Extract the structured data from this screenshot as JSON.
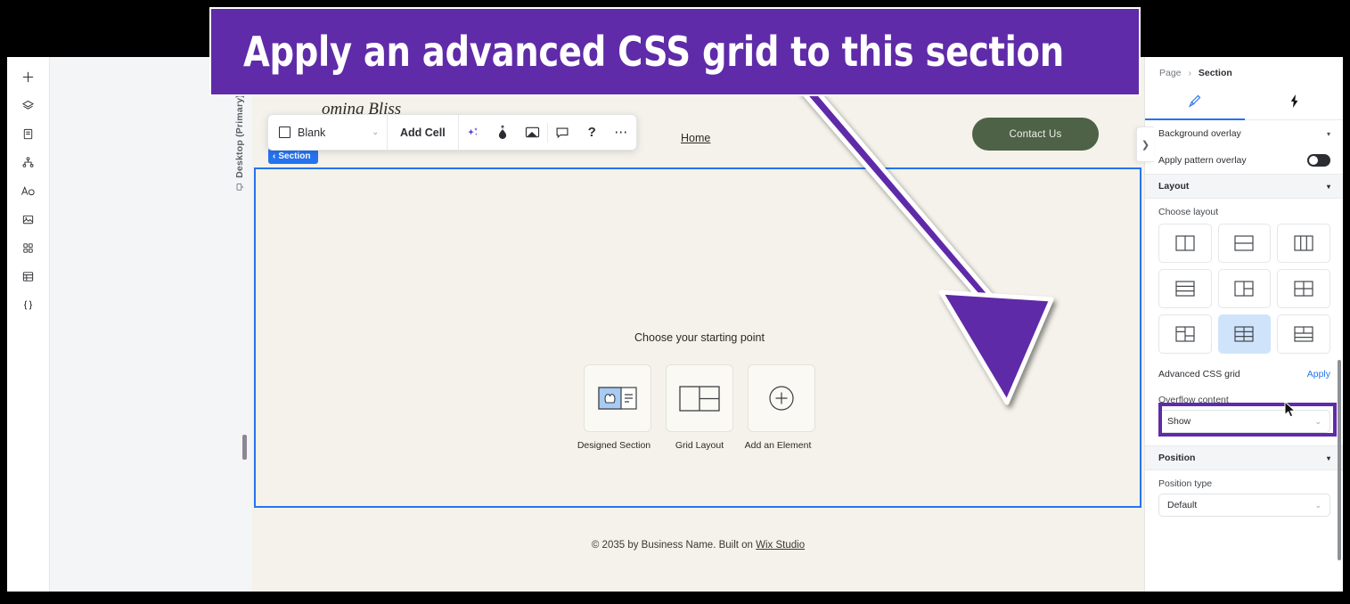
{
  "annotation": {
    "banner_text": "Apply an advanced CSS grid to this section",
    "banner_color": "#5f2ba8",
    "arrow_color": "#5f2ba8",
    "highlight_target": "Advanced CSS grid"
  },
  "left_rail": {
    "items": [
      {
        "icon": "plus-icon",
        "label": "Add"
      },
      {
        "icon": "layers-icon",
        "label": "Layers"
      },
      {
        "icon": "pages-icon",
        "label": "Pages"
      },
      {
        "icon": "site-structure-icon",
        "label": "Site Structure"
      },
      {
        "icon": "text-icon",
        "label": "Text"
      },
      {
        "icon": "media-icon",
        "label": "Media"
      },
      {
        "icon": "apps-icon",
        "label": "Apps"
      },
      {
        "icon": "cms-table-icon",
        "label": "CMS"
      },
      {
        "icon": "code-brackets-icon",
        "label": "Dev Mode"
      }
    ]
  },
  "gutter": {
    "viewport_label": "Desktop (Primary)",
    "viewport_icon": "monitor-icon"
  },
  "toolbar": {
    "preset_label": "Blank",
    "preset_icon": "square-outline-icon",
    "caret": "⌄",
    "add_cell_label": "Add Cell",
    "icons": [
      {
        "name": "ai-sparkles-icon",
        "glyph": "sparkles"
      },
      {
        "name": "paint-drop-icon",
        "glyph": "drop"
      },
      {
        "name": "media-frame-icon",
        "glyph": "frame"
      },
      {
        "name": "comment-icon",
        "glyph": "comment"
      },
      {
        "name": "help-icon",
        "glyph": "?"
      },
      {
        "name": "more-options-icon",
        "glyph": "⋯"
      }
    ]
  },
  "canvas": {
    "section_badge": "Section",
    "section_badge_chevron": "‹",
    "brand_text": "oming Bliss",
    "nav_home": "Home",
    "contact_button": "Contact Us",
    "contact_button_color": "#4e6247",
    "background_color": "#f4f2ea",
    "selection_border_color": "#2673f0",
    "starting_point": {
      "title": "Choose your starting point",
      "cards": [
        {
          "label": "Designed Section",
          "icon": "designed-section-icon"
        },
        {
          "label": "Grid Layout",
          "icon": "grid-layout-icon"
        },
        {
          "label": "Add an Element",
          "icon": "plus-circle-icon"
        }
      ]
    },
    "footer": {
      "prefix": "© 2035 by Business Name. Built on ",
      "link": "Wix Studio"
    }
  },
  "panel": {
    "breadcrumb": {
      "parent": "Page",
      "separator": "›",
      "current": "Section"
    },
    "tabs": [
      {
        "name": "design-tab",
        "icon": "paintbrush-icon",
        "active": true
      },
      {
        "name": "interactions-tab",
        "icon": "lightning-bolt-icon",
        "active": false
      }
    ],
    "rows": [
      {
        "label": "Background overlay",
        "control": "caret",
        "caret": "▾"
      },
      {
        "label": "Apply pattern overlay",
        "control": "toggle",
        "value": "off"
      }
    ],
    "layout_section": {
      "title": "Layout",
      "caret": "▾",
      "choose_layout_label": "Choose layout",
      "options": [
        {
          "name": "layout-two-columns",
          "selected": false
        },
        {
          "name": "layout-two-rows",
          "selected": false
        },
        {
          "name": "layout-three-columns",
          "selected": false
        },
        {
          "name": "layout-three-rows",
          "selected": false
        },
        {
          "name": "layout-left-col-split-right",
          "selected": false
        },
        {
          "name": "layout-four-quadrants",
          "selected": false
        },
        {
          "name": "layout-split-left-stack",
          "selected": false
        },
        {
          "name": "layout-six-cells",
          "selected": true
        },
        {
          "name": "layout-top-split-bottom-rows",
          "selected": false
        }
      ],
      "advanced": {
        "label": "Advanced CSS grid",
        "action": "Apply"
      },
      "overflow_label": "Overflow content",
      "overflow_value": "Show",
      "overflow_caret": "⌄"
    },
    "position_section": {
      "title": "Position",
      "caret": "▾",
      "type_label": "Position type",
      "type_value": "Default",
      "type_caret": "⌄"
    }
  }
}
